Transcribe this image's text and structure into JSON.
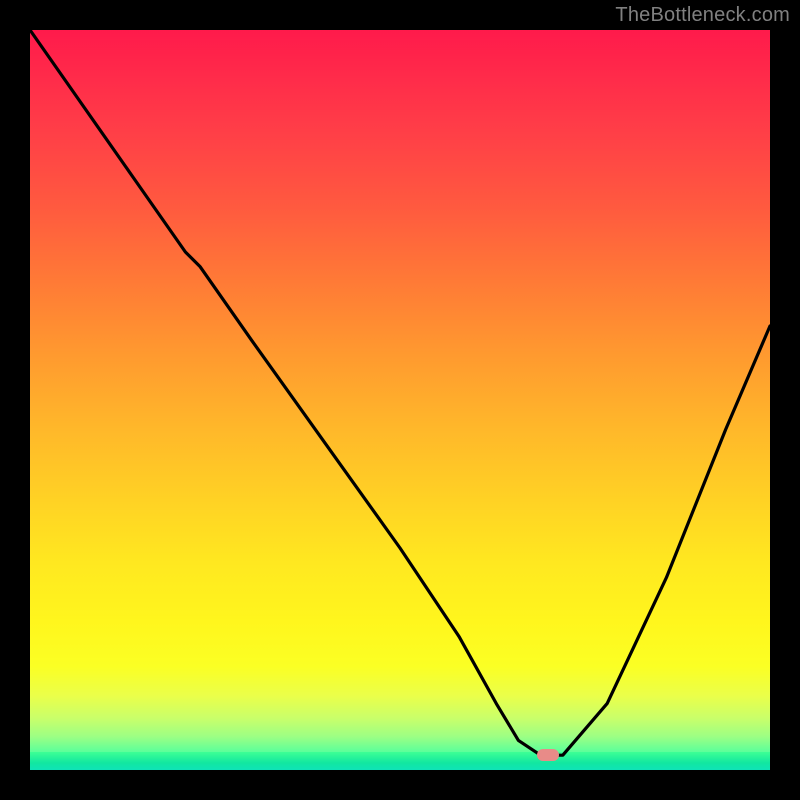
{
  "watermark": {
    "text": "TheBottleneck.com"
  },
  "colors": {
    "frame": "#000000",
    "curve_stroke": "#000000",
    "marker_fill": "#e88b88",
    "gradient_stops": [
      "#ff1a4b",
      "#ff2a4a",
      "#ff3f47",
      "#ff5a3f",
      "#ff7a36",
      "#ff9a2f",
      "#ffb82a",
      "#ffd324",
      "#ffe820",
      "#fff61d",
      "#fbff24",
      "#eaff4a",
      "#c9ff6a",
      "#9cff84",
      "#5dff9a",
      "#1dffba",
      "#0affdc"
    ],
    "green_strip": "#12e7a0"
  },
  "chart_data": {
    "type": "line",
    "title": "",
    "xlabel": "",
    "ylabel": "",
    "xlim": [
      0,
      100
    ],
    "ylim": [
      0,
      100
    ],
    "grid": false,
    "legend": null,
    "annotations": [
      {
        "kind": "watermark",
        "text": "TheBottleneck.com",
        "position": "top-right"
      },
      {
        "kind": "marker",
        "shape": "rounded-rect",
        "color": "#e88b88",
        "x": 70,
        "y": 2
      }
    ],
    "series": [
      {
        "name": "curve",
        "color": "#000000",
        "x": [
          0,
          7,
          14,
          21,
          23,
          30,
          40,
          50,
          58,
          63,
          66,
          69,
          72,
          78,
          86,
          94,
          100
        ],
        "y": [
          100,
          90,
          80,
          70,
          68,
          58,
          44,
          30,
          18,
          9,
          4,
          2,
          2,
          9,
          26,
          46,
          60
        ]
      }
    ]
  }
}
